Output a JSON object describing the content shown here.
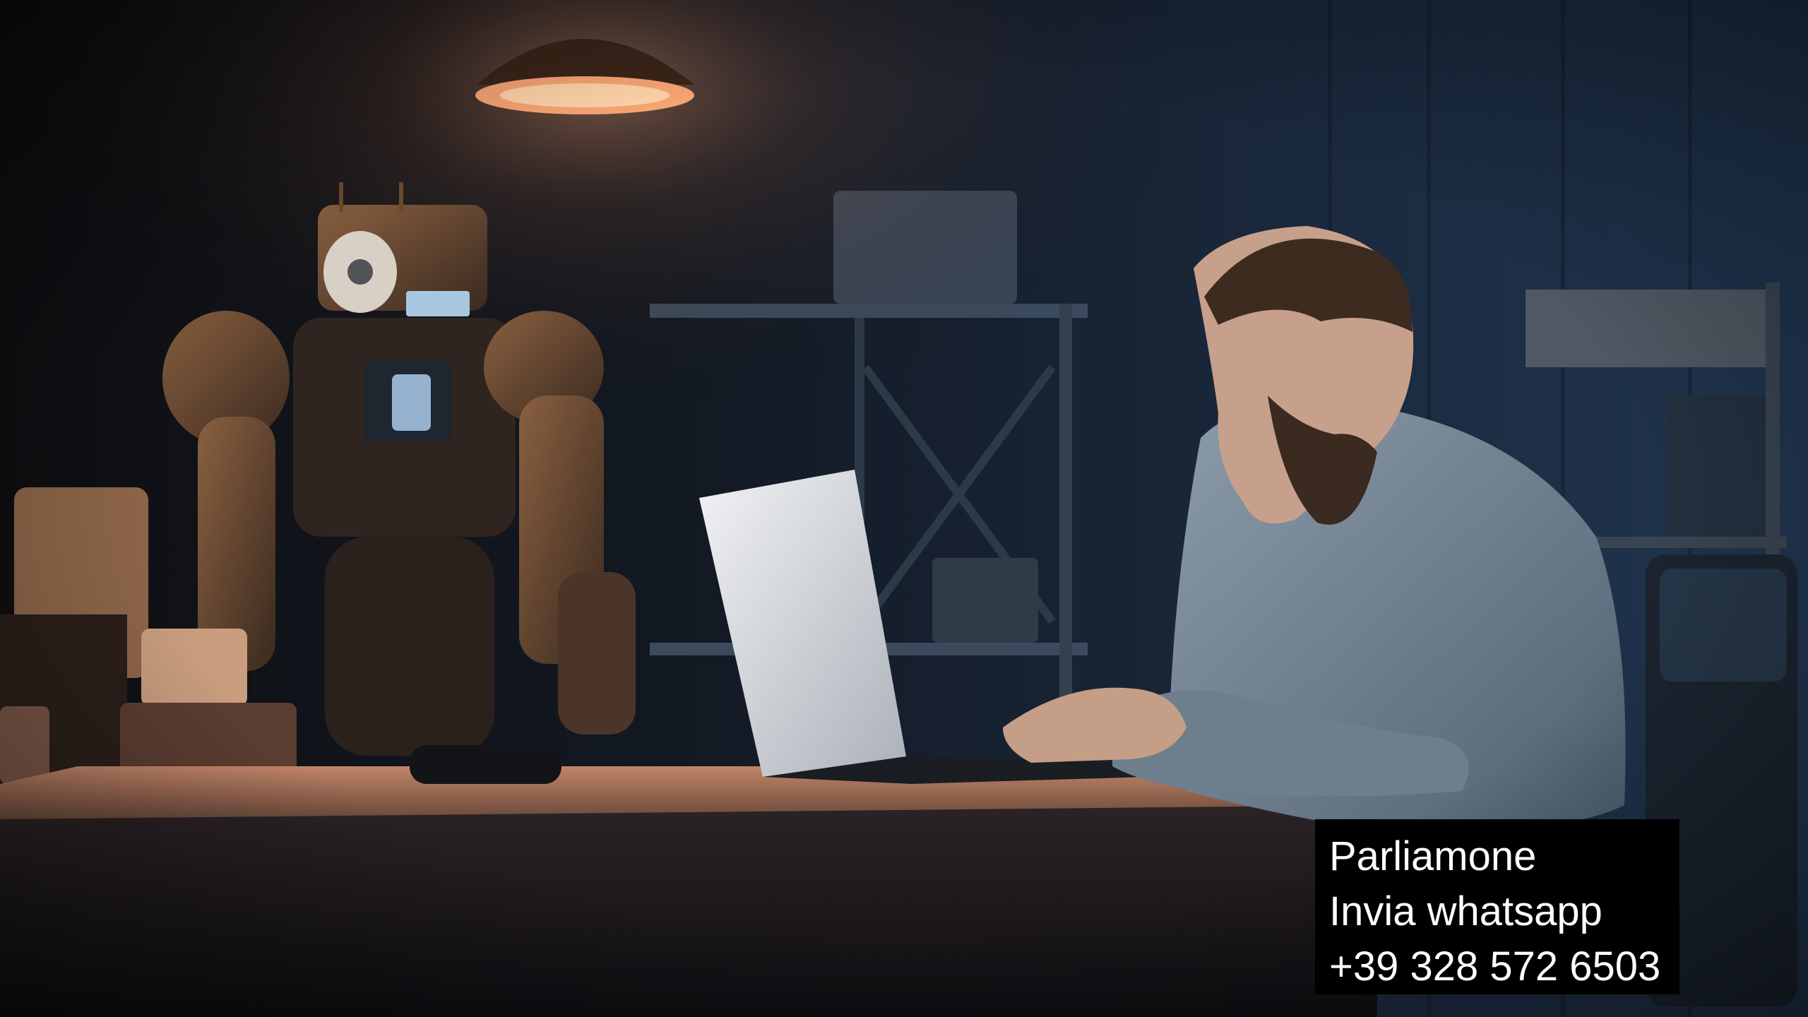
{
  "image": {
    "caption": {
      "line1": "Parliamone",
      "line2": "Invia whatsapp",
      "line3": "+39 328 572 6503"
    },
    "palette": {
      "background": "#0b0e14",
      "wall": "#1b2a3f",
      "lamp_glow": "#f7a574",
      "robot_bronze": "#6b4a2c",
      "desk_top": "#a7765a",
      "laptop": "#d9dbdf",
      "shirt": "#6c7f8f",
      "caption_background": "#000000",
      "caption_text": "#ffffff"
    }
  }
}
